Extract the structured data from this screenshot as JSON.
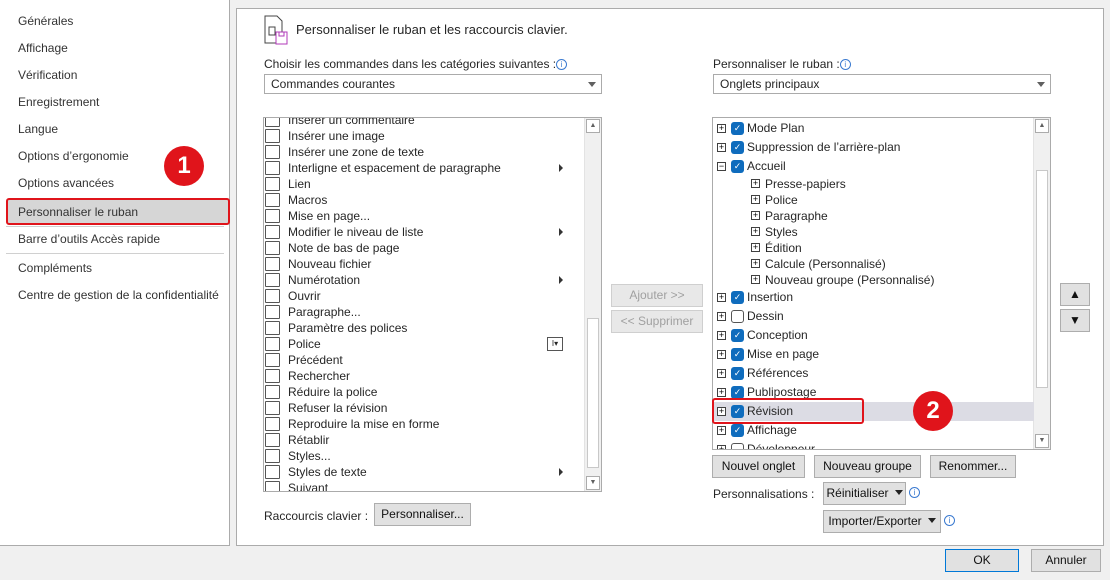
{
  "sidebar": {
    "items": [
      {
        "label": "Générales"
      },
      {
        "label": "Affichage"
      },
      {
        "label": "Vérification"
      },
      {
        "label": "Enregistrement"
      },
      {
        "label": "Langue"
      },
      {
        "label": "Options d’ergonomie"
      },
      {
        "label": "Options avancées"
      },
      {
        "label": "Personnaliser le ruban",
        "selected": true
      },
      {
        "label": "Barre d’outils Accès rapide"
      },
      {
        "label": "Compléments"
      },
      {
        "label": "Centre de gestion de la confidentialité"
      }
    ]
  },
  "header": {
    "title": "Personnaliser le ruban et les raccourcis clavier."
  },
  "commands": {
    "label": "Choisir les commandes dans les catégories suivantes :",
    "category": "Commandes courantes",
    "items": [
      {
        "label": "Insérer un commentaire"
      },
      {
        "label": "Insérer une image"
      },
      {
        "label": "Insérer une zone de texte"
      },
      {
        "label": "Interligne et espacement de paragraphe",
        "submenu": true
      },
      {
        "label": "Lien"
      },
      {
        "label": "Macros"
      },
      {
        "label": "Mise en page..."
      },
      {
        "label": "Modifier le niveau de liste",
        "submenu": true
      },
      {
        "label": "Note de bas de page"
      },
      {
        "label": "Nouveau fichier"
      },
      {
        "label": "Numérotation",
        "submenu": true
      },
      {
        "label": "Ouvrir"
      },
      {
        "label": "Paragraphe..."
      },
      {
        "label": "Paramètre des polices"
      },
      {
        "label": "Police",
        "combo": true
      },
      {
        "label": "Précédent"
      },
      {
        "label": "Rechercher"
      },
      {
        "label": "Réduire la police"
      },
      {
        "label": "Refuser la révision"
      },
      {
        "label": "Reproduire la mise en forme"
      },
      {
        "label": "Rétablir"
      },
      {
        "label": "Styles..."
      },
      {
        "label": "Styles de texte",
        "submenu": true
      },
      {
        "label": "Suivant"
      }
    ]
  },
  "shortcuts": {
    "label": "Raccourcis clavier :",
    "button": "Personnaliser..."
  },
  "middle": {
    "add": "Ajouter >>",
    "remove": "<< Supprimer"
  },
  "ribbon": {
    "label": "Personnaliser le ruban :",
    "selection": "Onglets principaux",
    "items": [
      {
        "label": "Mode Plan",
        "level": 0,
        "checked": true,
        "expanded": false
      },
      {
        "label": "Suppression de l’arrière-plan",
        "level": 0,
        "checked": true,
        "expanded": false
      },
      {
        "label": "Accueil",
        "level": 0,
        "checked": true,
        "expanded": true
      },
      {
        "label": "Presse-papiers",
        "level": 1
      },
      {
        "label": "Police",
        "level": 1
      },
      {
        "label": "Paragraphe",
        "level": 1
      },
      {
        "label": "Styles",
        "level": 1
      },
      {
        "label": "Édition",
        "level": 1
      },
      {
        "label": "Calcule (Personnalisé)",
        "level": 1
      },
      {
        "label": "Nouveau groupe (Personnalisé)",
        "level": 1
      },
      {
        "label": "Insertion",
        "level": 0,
        "checked": true
      },
      {
        "label": "Dessin",
        "level": 0,
        "checked": false
      },
      {
        "label": "Conception",
        "level": 0,
        "checked": true
      },
      {
        "label": "Mise en page",
        "level": 0,
        "checked": true
      },
      {
        "label": "Références",
        "level": 0,
        "checked": true
      },
      {
        "label": "Publipostage",
        "level": 0,
        "checked": true
      },
      {
        "label": "Révision",
        "level": 0,
        "checked": true,
        "selected": true
      },
      {
        "label": "Affichage",
        "level": 0,
        "checked": true
      },
      {
        "label": "Développeur",
        "level": 0,
        "checked": false
      }
    ],
    "new_tab": "Nouvel onglet",
    "new_group": "Nouveau groupe",
    "rename": "Renommer...",
    "customizations_label": "Personnalisations :",
    "reset": "Réinitialiser",
    "import_export": "Importer/Exporter"
  },
  "footer": {
    "ok": "OK",
    "cancel": "Annuler"
  },
  "annotations": {
    "one": "1",
    "two": "2"
  },
  "colors": {
    "accent": "#0f6cbd",
    "highlight": "#e0141b"
  }
}
